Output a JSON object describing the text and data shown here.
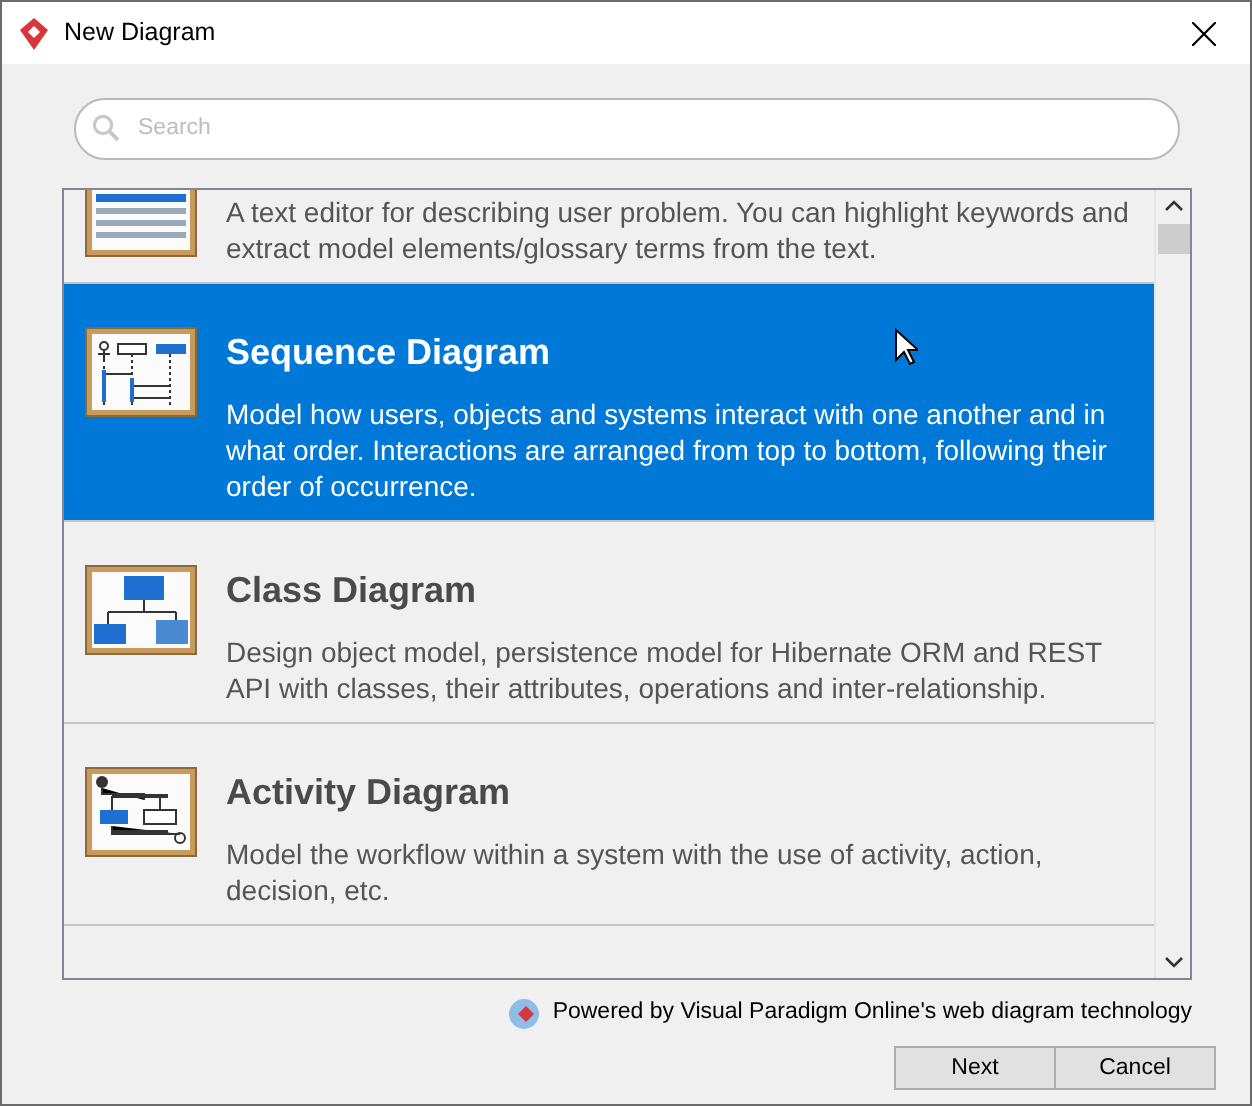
{
  "window": {
    "title": "New Diagram"
  },
  "search": {
    "placeholder": "Search"
  },
  "diagram_types": [
    {
      "description": "A text editor for describing user problem. You can highlight keywords and extract model elements/glossary terms from the text.",
      "selected": false
    },
    {
      "title": "Sequence Diagram",
      "description": "Model how users, objects and systems interact with one another and in what order. Interactions are arranged from top to bottom, following their order of occurrence.",
      "selected": true
    },
    {
      "title": "Class Diagram",
      "description": "Design object model, persistence model for Hibernate ORM and REST API with classes, their attributes, operations and inter-relationship.",
      "selected": false
    },
    {
      "title": "Activity Diagram",
      "description": "Model the workflow within a system with the use of activity, action, decision, etc.",
      "selected": false
    }
  ],
  "powered_by": "Powered by Visual Paradigm Online's web diagram technology",
  "buttons": [
    "Next",
    "Cancel"
  ]
}
